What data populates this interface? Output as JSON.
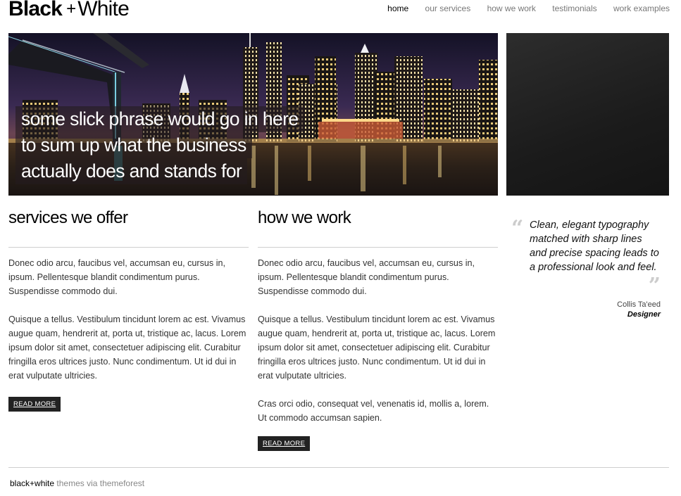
{
  "header": {
    "logo": {
      "black": "Black",
      "plus": "+",
      "white": "White"
    },
    "nav": [
      {
        "label": "home",
        "active": true
      },
      {
        "label": "our services"
      },
      {
        "label": "how we work"
      },
      {
        "label": "testimonials"
      },
      {
        "label": "work examples"
      }
    ]
  },
  "hero": {
    "lines": [
      "some slick phrase would go in here",
      "to sum up what the business",
      "actually does and stands for"
    ]
  },
  "services": {
    "title": "services we offer",
    "paragraphs": [
      "Donec odio arcu, faucibus vel, accumsan eu, cursus in, ipsum. Pellentesque blandit condimentum purus. Suspendisse commodo dui.",
      "Quisque a tellus. Vestibulum tincidunt lorem ac est. Vivamus augue quam, hendrerit at, porta ut, tristique ac, lacus. Lorem ipsum dolor sit amet, consectetuer adipiscing elit. Curabitur fringilla eros ultrices justo. Nunc condimentum. Ut id dui in erat vulputate ultricies."
    ],
    "button": "READ MORE"
  },
  "how_we_work": {
    "title": "how we work",
    "paragraphs": [
      "Donec odio arcu, faucibus vel, accumsan eu, cursus in, ipsum. Pellentesque blandit condimentum purus. Suspendisse commodo dui.",
      "Quisque a tellus. Vestibulum tincidunt lorem ac est. Vivamus augue quam, hendrerit at, porta ut, tristique ac, lacus. Lorem ipsum dolor sit amet, consectetuer adipiscing elit. Curabitur fringilla eros ultrices justo. Nunc condimentum. Ut id dui in erat vulputate ultricies.",
      "Cras orci odio, consequat vel, venenatis id, mollis a, lorem. Ut commodo accumsan sapien."
    ],
    "button": "READ MORE"
  },
  "testimonial": {
    "open_mark": "“",
    "close_mark": "”",
    "text": "Clean, elegant typography matched with sharp lines and precise spacing leads to a professional look and feel.",
    "author": "Collis Ta'eed",
    "role": "Designer"
  },
  "footer": {
    "brand": "black+white",
    "rest": "themes via themeforest"
  }
}
